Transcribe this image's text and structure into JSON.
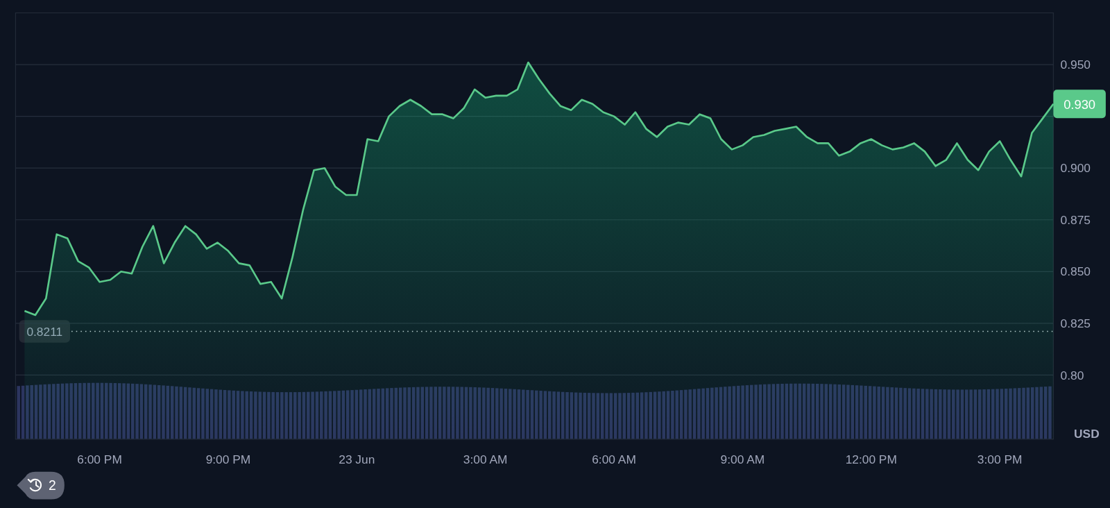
{
  "chart": {
    "chart_data": {
      "type": "area",
      "categories": [
        null,
        null,
        null,
        null,
        null,
        null,
        null,
        "6:00 PM",
        null,
        null,
        null,
        null,
        null,
        null,
        null,
        null,
        null,
        null,
        null,
        "9:00 PM",
        null,
        null,
        null,
        null,
        null,
        null,
        null,
        null,
        null,
        null,
        null,
        "23 Jun",
        null,
        null,
        null,
        null,
        null,
        null,
        null,
        null,
        null,
        null,
        null,
        "3:00 AM",
        null,
        null,
        null,
        null,
        null,
        null,
        null,
        null,
        null,
        null,
        null,
        "6:00 AM",
        null,
        null,
        null,
        null,
        null,
        null,
        null,
        null,
        null,
        null,
        null,
        "9:00 AM",
        null,
        null,
        null,
        null,
        null,
        null,
        null,
        null,
        null,
        null,
        null,
        "12:00 PM",
        null,
        null,
        null,
        null,
        null,
        null,
        null,
        null,
        null,
        null,
        null,
        "3:00 PM",
        null,
        null,
        null,
        null,
        null
      ],
      "values": [
        0.831,
        0.829,
        0.837,
        0.868,
        0.866,
        0.855,
        0.852,
        0.845,
        0.846,
        0.85,
        0.849,
        0.862,
        0.872,
        0.854,
        0.864,
        0.872,
        0.868,
        0.861,
        0.864,
        0.86,
        0.854,
        0.853,
        0.844,
        0.845,
        0.837,
        0.857,
        0.88,
        0.899,
        0.9,
        0.891,
        0.887,
        0.887,
        0.914,
        0.913,
        0.925,
        0.93,
        0.933,
        0.93,
        0.926,
        0.926,
        0.924,
        0.929,
        0.938,
        0.934,
        0.935,
        0.935,
        0.938,
        0.951,
        0.943,
        0.936,
        0.93,
        0.928,
        0.933,
        0.931,
        0.927,
        0.925,
        0.921,
        0.927,
        0.919,
        0.915,
        0.92,
        0.922,
        0.921,
        0.926,
        0.924,
        0.914,
        0.909,
        0.911,
        0.915,
        0.916,
        0.918,
        0.919,
        0.92,
        0.915,
        0.912,
        0.912,
        0.906,
        0.908,
        0.912,
        0.914,
        0.911,
        0.909,
        0.91,
        0.912,
        0.908,
        0.901,
        0.904,
        0.912,
        0.904,
        0.899,
        0.908,
        0.913,
        0.904,
        0.896,
        0.917,
        0.924,
        0.931
      ],
      "ylim": [
        0.769,
        0.975
      ],
      "grid": true,
      "yticks": [
        {
          "value": 0.95,
          "label": "0.950"
        },
        {
          "value": 0.9,
          "label": "0.900"
        },
        {
          "value": 0.875,
          "label": "0.875"
        },
        {
          "value": 0.85,
          "label": "0.850"
        },
        {
          "value": 0.825,
          "label": "0.825"
        },
        {
          "value": 0.8,
          "label": "0.80"
        }
      ]
    },
    "last_price": "0.930",
    "reference_price": "0.8211",
    "currency": "USD"
  },
  "history_badge": {
    "count": "2"
  }
}
